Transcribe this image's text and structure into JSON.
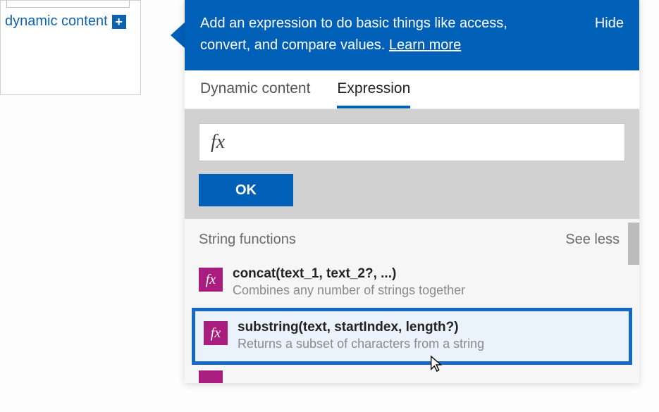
{
  "left": {
    "dynamic_content_label": "dynamic content"
  },
  "banner": {
    "text_part1": "Add an expression to do basic things like access, convert, and compare values. ",
    "learn_more": "Learn more",
    "hide": "Hide"
  },
  "tabs": {
    "dynamic": "Dynamic content",
    "expression": "Expression"
  },
  "editor": {
    "fx_symbol": "fx",
    "ok": "OK"
  },
  "section": {
    "title": "String functions",
    "toggle": "See less"
  },
  "functions": [
    {
      "icon_label": "fx",
      "title": "concat(text_1, text_2?, ...)",
      "desc": "Combines any number of strings together"
    },
    {
      "icon_label": "fx",
      "title": "substring(text, startIndex, length?)",
      "desc": "Returns a subset of characters from a string"
    }
  ],
  "colors": {
    "brand_blue": "#0060b8",
    "magenta": "#a91d7f"
  }
}
